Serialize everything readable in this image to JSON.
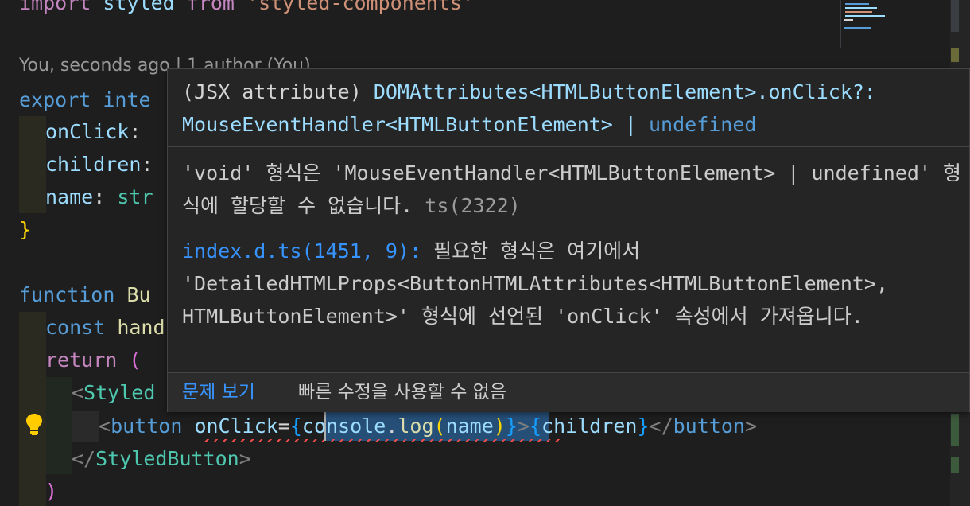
{
  "editor": {
    "line1": {
      "kw": "import",
      "name": "styled",
      "from": "from",
      "module": "'styled-components'"
    },
    "codelens": "You, seconds ago | 1 author (You)",
    "line2": {
      "kw": "export",
      "partial": "inte"
    },
    "line3": {
      "prop": "onClick",
      "colon": ":"
    },
    "line4": {
      "prop": "children",
      "colon": ":"
    },
    "line5": {
      "prop": "name",
      "colon": ":",
      "partial": "str"
    },
    "line6": {
      "brace": "}"
    },
    "line7": {
      "kw": "function",
      "partial": "Bu"
    },
    "line8": {
      "kw": "const",
      "partial": "hand"
    },
    "line9": {
      "kw": "return",
      "paren": "("
    },
    "line10": {
      "open": "<",
      "tag": "Styled"
    },
    "line11": {
      "open": "<",
      "tag": "button",
      "attr": "onClick",
      "eq": "=",
      "lbrace": "{",
      "obj": "console",
      "dot": ".",
      "method": "log",
      "lparen": "(",
      "arg": "name",
      "rparen": ")",
      "rbrace": "}",
      "close": ">",
      "lbrace2": "{",
      "children": "children",
      "rbrace2": "}",
      "endopen": "</",
      "endtag": "button",
      "endclose": ">"
    },
    "line12": {
      "endopen": "</",
      "tag": "StyledButton",
      "close": ">"
    },
    "line13": {
      "paren": ")"
    }
  },
  "hover": {
    "sig_prefix": "(JSX attribute) ",
    "sig_type": "DOMAttributes<HTMLButtonElement>.onClick?:",
    "sig_type2": "MouseEventHandler<HTMLButtonElement> | ",
    "sig_undefined": "undefined",
    "message": "'void' 형식은 'MouseEventHandler<HTMLButtonElement> | undefined' 형식에 할당할 수 없습니다.",
    "code": " ts(2322)",
    "related_link": "index.d.ts(1451, 9):",
    "related_text": " 필요한 형식은 여기에서 'DetailedHTMLProps<ButtonHTMLAttributes<HTMLButtonElement>, HTMLButtonElement>' 형식에 선언된 'onClick' 속성에서 가져옵니다.",
    "action_view_problem": "문제 보기",
    "no_quick_fix": "빠른 수정을 사용할 수 없음"
  },
  "colors": {
    "background": "#1e1e1e",
    "hover_bg": "#252526",
    "link": "#3794ff",
    "error": "#f14c4c"
  },
  "icons": {
    "lightbulb": "lightbulb-icon"
  }
}
